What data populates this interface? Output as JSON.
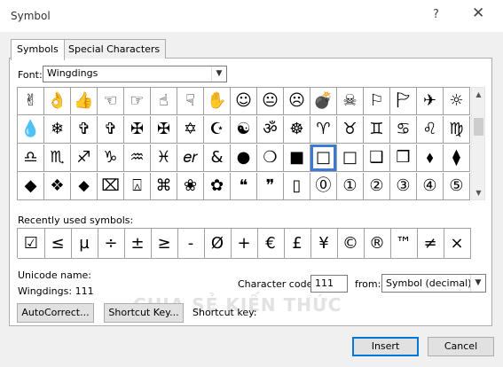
{
  "window": {
    "title": "Symbol",
    "help": "?",
    "close": "✕"
  },
  "tabs": {
    "symbols": "Symbols",
    "special": "Special Characters"
  },
  "font": {
    "label": "Font:",
    "value": "Wingdings"
  },
  "grid": {
    "selected_row": 2,
    "selected_col": 11,
    "rows": [
      [
        "✌",
        "👌",
        "👍",
        "☜",
        "☞",
        "☝",
        "☟",
        "✋",
        "☺",
        "😐",
        "☹",
        "💣",
        "☠",
        "⚐",
        "🏱",
        "✈",
        "☼"
      ],
      [
        "💧",
        "❄",
        "✞",
        "✞",
        "✠",
        "✠",
        "✡",
        "☪",
        "☯",
        "ॐ",
        "☸",
        "♈",
        "♉",
        "♊",
        "♋",
        "♌",
        "♍"
      ],
      [
        "♎",
        "♏",
        "♐",
        "♑",
        "♒",
        "♓",
        "𝑒𝑟",
        "&",
        "●",
        "❍",
        "■",
        "□",
        "□",
        "❑",
        "❒",
        "⬧",
        "⧫"
      ],
      [
        "◆",
        "❖",
        "⬥",
        "⌧",
        "⍓",
        "⌘",
        "❀",
        "✿",
        "❝",
        "❞",
        "▯",
        "⓪",
        "①",
        "②",
        "③",
        "④",
        "⑤"
      ]
    ]
  },
  "recent": {
    "label": "Recently used symbols:",
    "symbols": [
      "☑",
      "≤",
      "µ",
      "÷",
      "±",
      "≥",
      "-",
      "Ø",
      "+",
      "€",
      "£",
      "¥",
      "©",
      "®",
      "™",
      "≠",
      "×"
    ]
  },
  "unicode": {
    "label": "Unicode name:",
    "value": "Wingdings: 111"
  },
  "code": {
    "label": "Character code:",
    "value": "111"
  },
  "from": {
    "label": "from:",
    "value": "Symbol (decimal)"
  },
  "buttons": {
    "autocorrect": "AutoCorrect...",
    "shortcut_key": "Shortcut Key...",
    "insert": "Insert",
    "cancel": "Cancel"
  },
  "shortcut_label": "Shortcut key:",
  "watermark": "CHIA SẺ KIẾN THỨC"
}
